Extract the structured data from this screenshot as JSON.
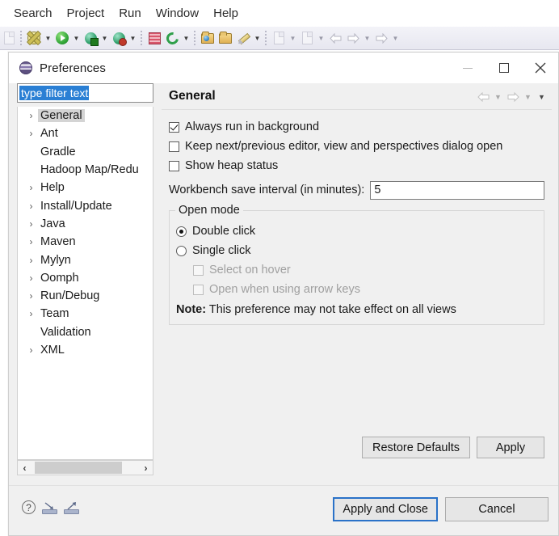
{
  "menubar": {
    "items": [
      {
        "label": "Search"
      },
      {
        "label": "Project"
      },
      {
        "label": "Run"
      },
      {
        "label": "Window"
      },
      {
        "label": "Help"
      }
    ]
  },
  "toolbar": {
    "icons": [
      {
        "name": "new-wizard-icon"
      },
      {
        "name": "run-icon"
      },
      {
        "name": "debug-icon"
      },
      {
        "name": "coverage-icon"
      },
      {
        "name": "new-java-package-icon"
      },
      {
        "name": "git-icon"
      },
      {
        "name": "open-type-icon"
      },
      {
        "name": "open-resource-icon"
      },
      {
        "name": "quick-access-icon"
      },
      {
        "name": "document-icon"
      },
      {
        "name": "editor-icon"
      },
      {
        "name": "back-icon"
      },
      {
        "name": "forward-icon"
      },
      {
        "name": "next-annotation-icon"
      }
    ]
  },
  "dialog": {
    "title": "Preferences",
    "title_icon": "eclipse-globe-icon",
    "window_controls": {
      "minimize": "minimize-icon",
      "maximize": "maximize-icon",
      "close": "close-icon"
    },
    "filter": {
      "value": "type filter text",
      "placeholder": "type filter text"
    },
    "tree": {
      "items": [
        {
          "label": "General",
          "expandable": true,
          "selected": true
        },
        {
          "label": "Ant",
          "expandable": true,
          "selected": false
        },
        {
          "label": "Gradle",
          "expandable": false,
          "selected": false
        },
        {
          "label": "Hadoop Map/Redu",
          "expandable": false,
          "selected": false
        },
        {
          "label": "Help",
          "expandable": true,
          "selected": false
        },
        {
          "label": "Install/Update",
          "expandable": true,
          "selected": false
        },
        {
          "label": "Java",
          "expandable": true,
          "selected": false
        },
        {
          "label": "Maven",
          "expandable": true,
          "selected": false
        },
        {
          "label": "Mylyn",
          "expandable": true,
          "selected": false
        },
        {
          "label": "Oomph",
          "expandable": true,
          "selected": false
        },
        {
          "label": "Run/Debug",
          "expandable": true,
          "selected": false
        },
        {
          "label": "Team",
          "expandable": true,
          "selected": false
        },
        {
          "label": "Validation",
          "expandable": false,
          "selected": false
        },
        {
          "label": "XML",
          "expandable": true,
          "selected": false
        }
      ]
    },
    "scrollbar": {
      "left_arrow": "chevron-left-icon",
      "right_arrow": "chevron-right-icon"
    },
    "page": {
      "title": "General",
      "nav": {
        "back_icon": "back-arrow-icon",
        "back_menu_icon": "chevron-down-icon",
        "forward_icon": "forward-arrow-icon",
        "forward_menu_icon": "chevron-down-icon",
        "view_menu_icon": "chevron-down-icon"
      },
      "checkboxes": [
        {
          "label": "Always run in background",
          "checked": true,
          "disabled": false
        },
        {
          "label": "Keep next/previous editor, view and perspectives dialog open",
          "checked": false,
          "disabled": false
        },
        {
          "label": "Show heap status",
          "checked": false,
          "disabled": false
        }
      ],
      "save_interval": {
        "label": "Workbench save interval (in minutes):",
        "value": "5"
      },
      "open_mode": {
        "title": "Open mode",
        "options": [
          {
            "label": "Double click",
            "selected": true
          },
          {
            "label": "Single click",
            "selected": false
          }
        ],
        "sub_options": [
          {
            "label": "Select on hover",
            "checked": false,
            "disabled": true
          },
          {
            "label": "Open when using arrow keys",
            "checked": false,
            "disabled": true
          }
        ],
        "note_prefix": "Note:",
        "note_text": "This preference may not take effect on all views"
      },
      "buttons": {
        "restore_defaults": "Restore Defaults",
        "apply": "Apply"
      }
    },
    "footer": {
      "icons": [
        {
          "name": "help-icon",
          "glyph": "?"
        },
        {
          "name": "import-preferences-icon"
        },
        {
          "name": "export-preferences-icon"
        }
      ],
      "buttons": {
        "apply_and_close": "Apply and Close",
        "cancel": "Cancel"
      }
    }
  },
  "colors": {
    "accent": "#2a72c8",
    "selection": "#2a7fd4",
    "dialog_bg": "#f0f0f0"
  }
}
